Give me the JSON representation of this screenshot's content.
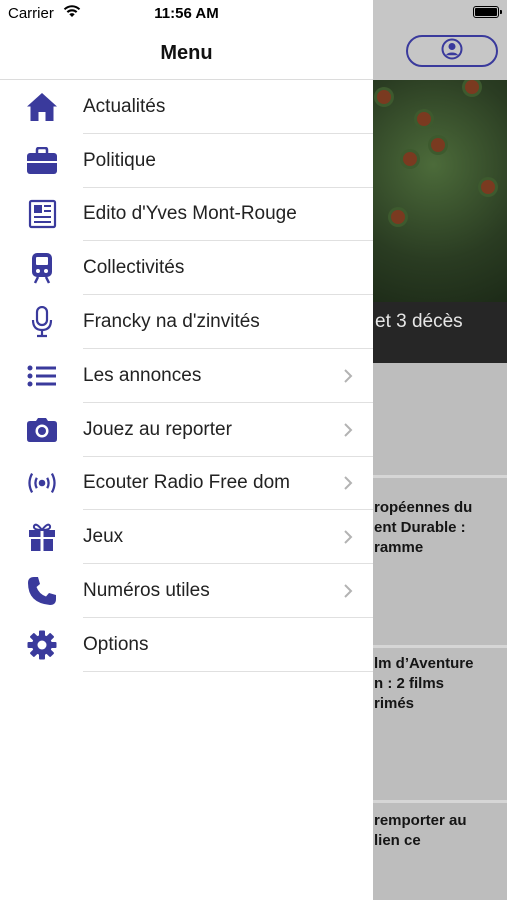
{
  "status_bar": {
    "carrier": "Carrier",
    "time": "11:56 AM"
  },
  "colors": {
    "accent": "#3a3a9c"
  },
  "drawer": {
    "title": "Menu",
    "items": [
      {
        "label": "Actualités",
        "icon": "home-icon",
        "chevron": false
      },
      {
        "label": "Politique",
        "icon": "briefcase-icon",
        "chevron": false
      },
      {
        "label": "Edito d'Yves Mont-Rouge",
        "icon": "newspaper-icon",
        "chevron": false
      },
      {
        "label": "Collectivités",
        "icon": "train-icon",
        "chevron": false
      },
      {
        "label": "Francky na d'zinvités",
        "icon": "microphone-icon",
        "chevron": false
      },
      {
        "label": "Les annonces",
        "icon": "list-icon",
        "chevron": true
      },
      {
        "label": "Jouez au reporter",
        "icon": "camera-icon",
        "chevron": true
      },
      {
        "label": "Ecouter Radio Free dom",
        "icon": "broadcast-icon",
        "chevron": true
      },
      {
        "label": "Jeux",
        "icon": "gift-icon",
        "chevron": true
      },
      {
        "label": "Numéros utiles",
        "icon": "phone-icon",
        "chevron": true
      },
      {
        "label": "Options",
        "icon": "gear-icon",
        "chevron": false
      }
    ]
  },
  "background": {
    "profile_icon": "user-circle-icon",
    "hero_caption": "et 3 décès",
    "articles": [
      {
        "lines": [
          "ropéennes du",
          "ent Durable :",
          "ramme"
        ]
      },
      {
        "lines": [
          "lm d’Aventure",
          "n : 2 films",
          "rimés"
        ]
      },
      {
        "lines": [
          " remporter au",
          "lien ce"
        ]
      }
    ]
  }
}
